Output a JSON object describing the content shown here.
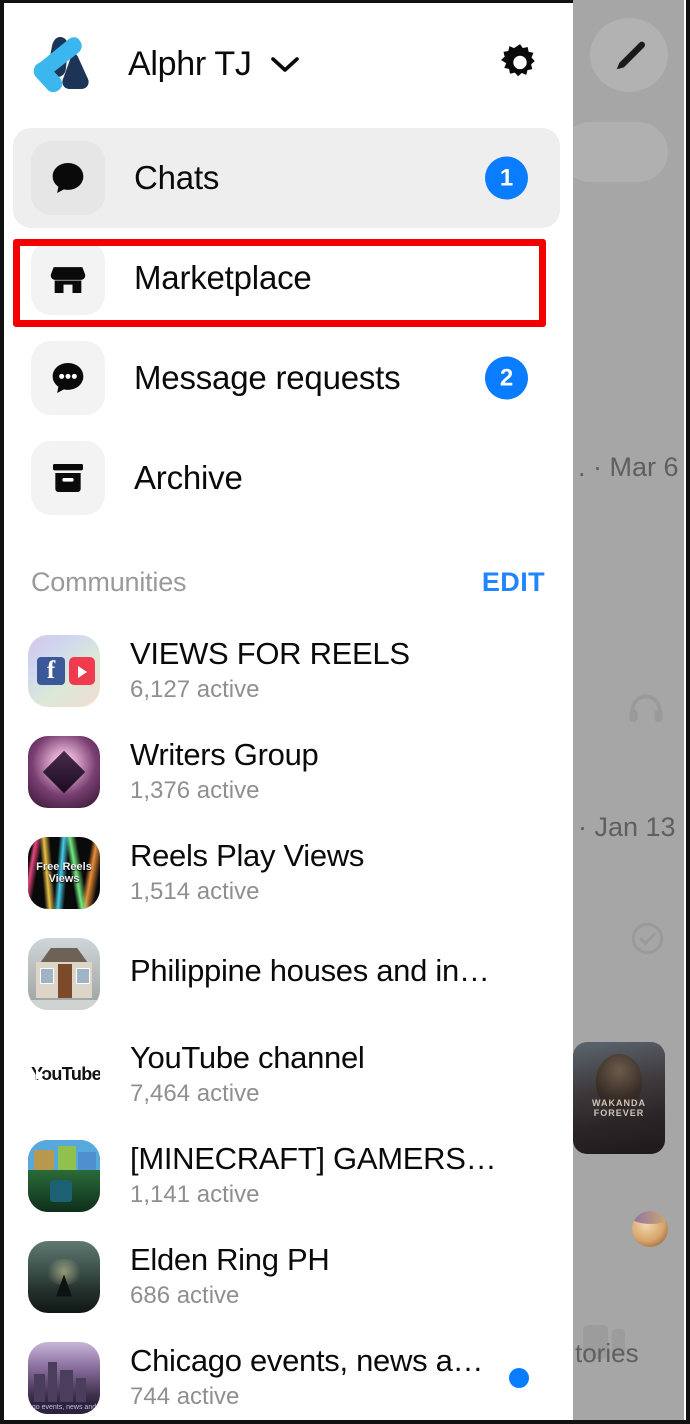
{
  "header": {
    "account_name": "Alphr TJ",
    "chevron_icon": "chevron-down-icon",
    "settings_icon": "gear-icon",
    "logo_icon": "alphr-logo"
  },
  "nav": {
    "items": [
      {
        "label": "Chats",
        "icon": "chat-bubble-icon",
        "badge": "1",
        "active": true
      },
      {
        "label": "Marketplace",
        "icon": "storefront-icon",
        "badge": "",
        "active": false
      },
      {
        "label": "Message requests",
        "icon": "chat-dots-icon",
        "badge": "2",
        "active": false
      },
      {
        "label": "Archive",
        "icon": "archive-box-icon",
        "badge": "",
        "active": false
      }
    ]
  },
  "communities": {
    "title": "Communities",
    "edit_label": "EDIT",
    "items": [
      {
        "name": "VIEWS FOR REELS",
        "active": "6,127 active",
        "unread": false
      },
      {
        "name": "Writers Group",
        "active": "1,376 active",
        "unread": false
      },
      {
        "name": "Reels Play Views",
        "active": "1,514 active",
        "unread": false
      },
      {
        "name": "Philippine houses and in…",
        "active": "",
        "unread": false
      },
      {
        "name": "YouTube channel",
        "active": "7,464 active",
        "unread": false
      },
      {
        "name": "[MINECRAFT] GAMERS…",
        "active": "1,141 active",
        "unread": false
      },
      {
        "name": "Elden Ring PH",
        "active": "686 active",
        "unread": false
      },
      {
        "name": "Chicago  events, news a…",
        "active": "744 active",
        "unread": true
      }
    ]
  },
  "background": {
    "compose_icon": "pencil-compose-icon",
    "date_mar": ". · Mar 6",
    "date_jan": "· Jan 13",
    "headphone_icon": "headphones-icon",
    "check_icon": "check-circle-icon",
    "story_label": "tories",
    "thumb_caption": "WAKANDA FOREVER"
  },
  "annotation": {
    "highlight_target": "Marketplace",
    "highlight_color": "#f50000"
  },
  "colors": {
    "badge_blue": "#0a7cff",
    "edit_blue": "#1f86ff",
    "row_active_bg": "#eeeeee",
    "icon_tile_bg": "#f3f3f3"
  }
}
